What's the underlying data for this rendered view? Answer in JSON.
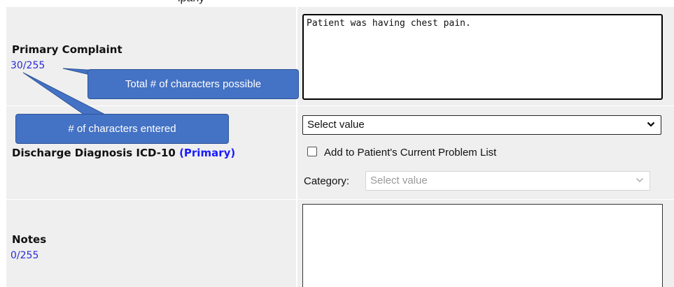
{
  "header": {
    "cut_off_text": "ipany"
  },
  "primary_complaint": {
    "label": "Primary Complaint",
    "counter": "30/255",
    "value": "Patient was having chest pain."
  },
  "discharge_diagnosis": {
    "label": "Discharge Diagnosis ICD-10",
    "primary_tag": "(Primary)",
    "select_value": "Select value",
    "add_to_list_label": "Add to Patient's Current Problem List",
    "add_to_list_checked": false,
    "category_label": "Category:",
    "category_value": "Select value"
  },
  "notes": {
    "label": "Notes",
    "counter": "0/255",
    "value": ""
  },
  "callouts": {
    "total": "Total # of characters possible",
    "entered": "# of characters entered"
  },
  "colors": {
    "callout_fill": "#4472c4",
    "counter_text": "#2b2bd6",
    "primary_tag": "#1a1aff",
    "row_background": "#efefef"
  }
}
